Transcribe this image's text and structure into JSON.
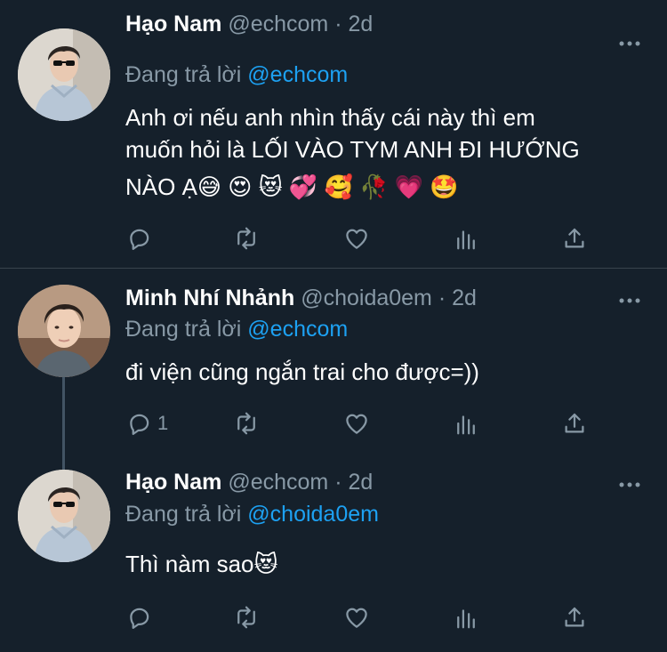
{
  "tweets": [
    {
      "name": "Hạo Nam",
      "handle": "@echcom",
      "sep": " · ",
      "time": "2d",
      "reply_prefix": "Đang trả lời ",
      "reply_to": "@echcom",
      "text_lines": [
        "Anh ơi nếu anh nhìn thấy cái này thì em",
        "muốn hỏi là LỐI VÀO TYM ANH ĐI HƯỚNG",
        "NÀO Ạ😅 😍 😻 💞 🥰 🥀 💗 🤩"
      ],
      "reply_count": ""
    },
    {
      "name": "Minh Nhí Nhảnh",
      "handle": "@choida0em",
      "sep": " · ",
      "time": "2d",
      "reply_prefix": "Đang trả lời ",
      "reply_to": "@echcom",
      "text_lines": [
        "đi viện cũng ngắn trai cho được=))"
      ],
      "reply_count": "1"
    },
    {
      "name": "Hạo Nam",
      "handle": "@echcom",
      "sep": " · ",
      "time": "2d",
      "reply_prefix": "Đang trả lời ",
      "reply_to": "@choida0em",
      "text_lines": [
        "Thì nàm sao😻"
      ],
      "reply_count": ""
    }
  ],
  "icons": {
    "reply": "reply-icon",
    "retweet": "retweet-icon",
    "like": "heart-icon",
    "analytics": "analytics-icon",
    "share": "share-icon",
    "more": "more-icon"
  },
  "colors": {
    "background": "#15202b",
    "muted": "#8899a6",
    "link": "#1da1f2",
    "divider": "#38444d"
  }
}
